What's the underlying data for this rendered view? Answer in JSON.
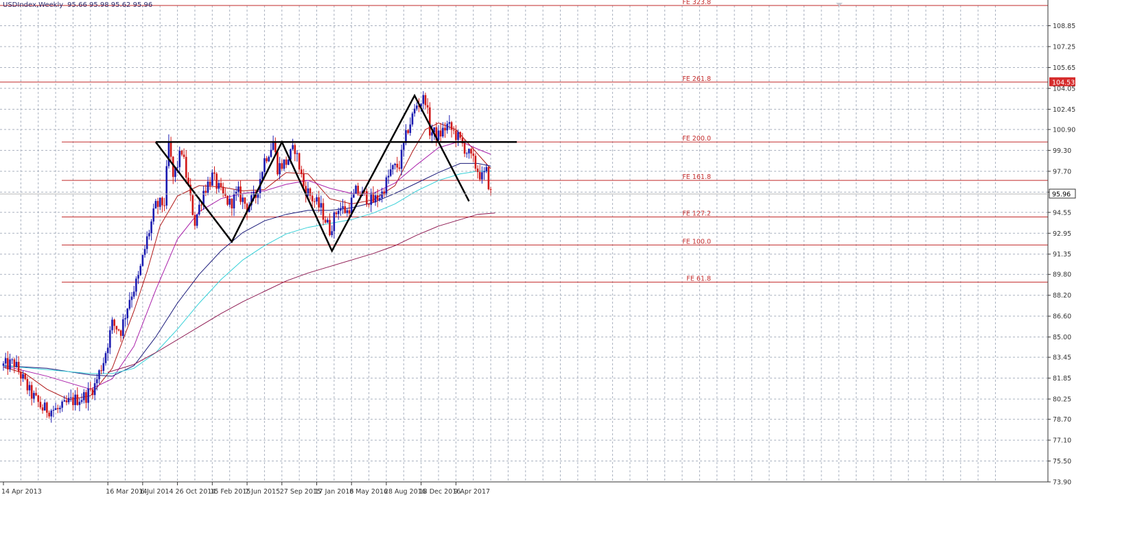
{
  "header": {
    "symbol": "USDIndex,Weekly",
    "ohlc": "95.66 95.98 95.62 95.96"
  },
  "chart_data": {
    "type": "candlestick",
    "title": "USDIndex,Weekly",
    "grid": true,
    "ylim": [
      73.9,
      110.4
    ],
    "y_ticks": [
      108.85,
      107.25,
      105.65,
      104.05,
      102.45,
      100.9,
      99.3,
      97.7,
      96.1,
      94.55,
      92.95,
      91.35,
      89.8,
      88.2,
      86.6,
      85.0,
      83.45,
      81.85,
      80.25,
      78.7,
      77.1,
      75.5,
      73.9
    ],
    "y_tick_labels": [
      "108.85",
      "107.25",
      "105.65",
      "104.05",
      "102.45",
      "100.90",
      "99.30",
      "97.70",
      "96.10",
      "94.55",
      "92.95",
      "91.35",
      "89.80",
      "88.20",
      "86.60",
      "85.00",
      "83.45",
      "81.85",
      "80.25",
      "78.70",
      "77.10",
      "75.50",
      "73.90"
    ],
    "x_tick_labels": [
      "14 Apr 2013",
      "16 Mar 2014",
      "6 Jul 2014",
      "26 Oct 2014",
      "15 Feb 2015",
      "7 Jun 2015",
      "27 Sep 2015",
      "17 Jan 2016",
      "8 May 2016",
      "28 Aug 2016",
      "18 Dec 2016",
      "9 Apr 2017"
    ],
    "x_tick_bars": [
      0,
      48,
      64,
      80,
      96,
      112,
      128,
      144,
      160,
      176,
      192,
      208
    ],
    "bar_count": 225,
    "current_price": 95.96,
    "current_price_label": "95.96",
    "fe_levels": [
      {
        "label": "FE 323.8",
        "value": 110.4
      },
      {
        "label": "FE 261.8",
        "value": 104.53,
        "tag": "104.53"
      },
      {
        "label": "FE 200.0",
        "value": 99.94
      },
      {
        "label": "FE 161.8",
        "value": 97.0
      },
      {
        "label": "FE 127.2",
        "value": 94.2
      },
      {
        "label": "FE 100.0",
        "value": 92.05
      },
      {
        "label": "FE 61.8",
        "value": 89.2
      }
    ],
    "neckline": {
      "from_bar": 70,
      "to_bar": 236,
      "value": 99.94
    },
    "pattern_points": [
      {
        "bar": 70,
        "value": 99.94
      },
      {
        "bar": 105,
        "value": 92.3
      },
      {
        "bar": 128,
        "value": 99.94
      },
      {
        "bar": 151,
        "value": 91.6
      },
      {
        "bar": 189,
        "value": 103.5
      },
      {
        "bar": 214,
        "value": 95.4
      }
    ],
    "key_prices": [
      {
        "bar": 0,
        "value": 82.8
      },
      {
        "bar": 5,
        "value": 83.0
      },
      {
        "bar": 12,
        "value": 80.8
      },
      {
        "bar": 18,
        "value": 79.5
      },
      {
        "bar": 26,
        "value": 79.4
      },
      {
        "bar": 30,
        "value": 80.0
      },
      {
        "bar": 38,
        "value": 80.5
      },
      {
        "bar": 42,
        "value": 81.3
      },
      {
        "bar": 46,
        "value": 83.2
      },
      {
        "bar": 50,
        "value": 86.0
      },
      {
        "bar": 54,
        "value": 85.5
      },
      {
        "bar": 58,
        "value": 88.0
      },
      {
        "bar": 62,
        "value": 89.5
      },
      {
        "bar": 66,
        "value": 92.5
      },
      {
        "bar": 70,
        "value": 95.0
      },
      {
        "bar": 74,
        "value": 95.3
      },
      {
        "bar": 76,
        "value": 99.8
      },
      {
        "bar": 78,
        "value": 97.2
      },
      {
        "bar": 82,
        "value": 99.3
      },
      {
        "bar": 86,
        "value": 95.5
      },
      {
        "bar": 88,
        "value": 93.8
      },
      {
        "bar": 92,
        "value": 96.2
      },
      {
        "bar": 96,
        "value": 97.3
      },
      {
        "bar": 100,
        "value": 96.0
      },
      {
        "bar": 104,
        "value": 95.2
      },
      {
        "bar": 108,
        "value": 96.0
      },
      {
        "bar": 112,
        "value": 95.0
      },
      {
        "bar": 116,
        "value": 95.8
      },
      {
        "bar": 120,
        "value": 98.6
      },
      {
        "bar": 124,
        "value": 99.9
      },
      {
        "bar": 126,
        "value": 98.0
      },
      {
        "bar": 130,
        "value": 98.4
      },
      {
        "bar": 134,
        "value": 99.5
      },
      {
        "bar": 138,
        "value": 96.6
      },
      {
        "bar": 142,
        "value": 95.6
      },
      {
        "bar": 146,
        "value": 94.8
      },
      {
        "bar": 150,
        "value": 93.2
      },
      {
        "bar": 154,
        "value": 95.0
      },
      {
        "bar": 158,
        "value": 94.6
      },
      {
        "bar": 162,
        "value": 96.1
      },
      {
        "bar": 166,
        "value": 95.8
      },
      {
        "bar": 170,
        "value": 95.4
      },
      {
        "bar": 174,
        "value": 96.0
      },
      {
        "bar": 178,
        "value": 97.7
      },
      {
        "bar": 182,
        "value": 98.2
      },
      {
        "bar": 186,
        "value": 101.0
      },
      {
        "bar": 190,
        "value": 102.8
      },
      {
        "bar": 194,
        "value": 103.3
      },
      {
        "bar": 196,
        "value": 100.8
      },
      {
        "bar": 200,
        "value": 100.4
      },
      {
        "bar": 204,
        "value": 101.2
      },
      {
        "bar": 208,
        "value": 100.5
      },
      {
        "bar": 212,
        "value": 99.5
      },
      {
        "bar": 216,
        "value": 98.4
      },
      {
        "bar": 220,
        "value": 97.2
      },
      {
        "bar": 222,
        "value": 97.6
      },
      {
        "bar": 224,
        "value": 95.96
      }
    ],
    "moving_averages": [
      {
        "color": "#b01616",
        "points": [
          [
            0,
            82.7
          ],
          [
            10,
            82.2
          ],
          [
            20,
            81.0
          ],
          [
            30,
            80.2
          ],
          [
            40,
            80.5
          ],
          [
            50,
            82.6
          ],
          [
            60,
            87.0
          ],
          [
            66,
            90.0
          ],
          [
            72,
            93.5
          ],
          [
            80,
            95.8
          ],
          [
            90,
            96.6
          ],
          [
            100,
            96.5
          ],
          [
            110,
            96.2
          ],
          [
            120,
            96.3
          ],
          [
            130,
            97.6
          ],
          [
            140,
            97.5
          ],
          [
            150,
            95.6
          ],
          [
            160,
            95.2
          ],
          [
            170,
            95.5
          ],
          [
            180,
            96.6
          ],
          [
            188,
            99.2
          ],
          [
            194,
            100.9
          ],
          [
            200,
            101.4
          ],
          [
            208,
            100.9
          ],
          [
            216,
            99.4
          ],
          [
            224,
            97.9
          ]
        ]
      },
      {
        "color": "#aa20aa",
        "points": [
          [
            0,
            82.8
          ],
          [
            20,
            82.0
          ],
          [
            40,
            81.0
          ],
          [
            50,
            81.8
          ],
          [
            60,
            84.3
          ],
          [
            70,
            88.6
          ],
          [
            80,
            92.5
          ],
          [
            90,
            94.6
          ],
          [
            100,
            95.6
          ],
          [
            110,
            96.0
          ],
          [
            120,
            96.2
          ],
          [
            130,
            96.7
          ],
          [
            140,
            97.0
          ],
          [
            150,
            96.4
          ],
          [
            160,
            96.0
          ],
          [
            170,
            96.0
          ],
          [
            180,
            96.8
          ],
          [
            190,
            98.2
          ],
          [
            200,
            99.5
          ],
          [
            210,
            100.0
          ],
          [
            218,
            99.4
          ],
          [
            224,
            99.0
          ]
        ]
      },
      {
        "color": "#1a1a7a",
        "points": [
          [
            0,
            82.8
          ],
          [
            20,
            82.6
          ],
          [
            40,
            82.1
          ],
          [
            50,
            82.0
          ],
          [
            60,
            82.8
          ],
          [
            70,
            85.0
          ],
          [
            80,
            87.6
          ],
          [
            90,
            89.8
          ],
          [
            100,
            91.6
          ],
          [
            110,
            93.0
          ],
          [
            120,
            93.9
          ],
          [
            130,
            94.4
          ],
          [
            140,
            94.7
          ],
          [
            150,
            94.7
          ],
          [
            160,
            94.9
          ],
          [
            170,
            95.3
          ],
          [
            180,
            96.0
          ],
          [
            190,
            96.8
          ],
          [
            200,
            97.6
          ],
          [
            210,
            98.3
          ],
          [
            218,
            98.3
          ],
          [
            224,
            98.1
          ]
        ]
      },
      {
        "color": "#35d0d8",
        "points": [
          [
            0,
            82.8
          ],
          [
            20,
            82.5
          ],
          [
            40,
            82.2
          ],
          [
            50,
            82.2
          ],
          [
            60,
            82.6
          ],
          [
            70,
            83.8
          ],
          [
            80,
            85.6
          ],
          [
            90,
            87.6
          ],
          [
            100,
            89.4
          ],
          [
            110,
            90.9
          ],
          [
            120,
            92.0
          ],
          [
            130,
            92.9
          ],
          [
            140,
            93.4
          ],
          [
            150,
            93.7
          ],
          [
            160,
            94.0
          ],
          [
            170,
            94.5
          ],
          [
            180,
            95.2
          ],
          [
            190,
            96.2
          ],
          [
            200,
            97.0
          ],
          [
            210,
            97.5
          ],
          [
            218,
            97.7
          ],
          [
            224,
            97.7
          ]
        ]
      },
      {
        "color": "#8e1a52",
        "points": [
          [
            48,
            82.3
          ],
          [
            60,
            82.9
          ],
          [
            70,
            83.8
          ],
          [
            80,
            84.8
          ],
          [
            90,
            85.8
          ],
          [
            100,
            86.8
          ],
          [
            110,
            87.7
          ],
          [
            120,
            88.5
          ],
          [
            130,
            89.3
          ],
          [
            140,
            89.9
          ],
          [
            150,
            90.4
          ],
          [
            160,
            90.9
          ],
          [
            170,
            91.4
          ],
          [
            180,
            92.0
          ],
          [
            190,
            92.8
          ],
          [
            200,
            93.5
          ],
          [
            210,
            94.0
          ],
          [
            218,
            94.4
          ],
          [
            226,
            94.5
          ]
        ]
      }
    ]
  }
}
